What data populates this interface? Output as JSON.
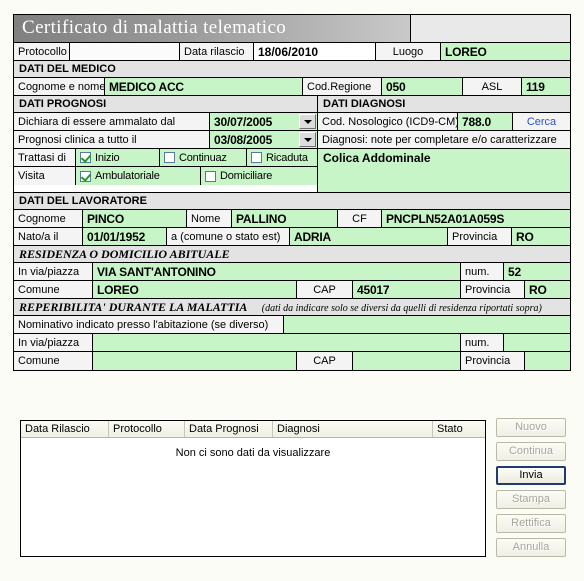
{
  "title": "Certificato di malattia telematico",
  "header_row": {
    "protocollo_label": "Protocollo",
    "protocollo_value": "",
    "data_rilascio_label": "Data rilascio",
    "data_rilascio_value": "18/06/2010",
    "luogo_label": "Luogo",
    "luogo_value": "LOREO"
  },
  "medico": {
    "section": "DATI DEL MEDICO",
    "cognome_label": "Cognome e nome",
    "cognome_value": "MEDICO ACC",
    "cod_regione_label": "Cod.Regione",
    "cod_regione_value": "050",
    "asl_label": "ASL",
    "asl_value": "119"
  },
  "prognosi": {
    "section": "DATI PROGNOSI",
    "ammalato_label": "Dichiara di essere ammalato dal",
    "ammalato_value": "30/07/2005",
    "prognosi_label": "Prognosi clinica a tutto il",
    "prognosi_value": "03/08/2005",
    "trattasi_label": "Trattasi di",
    "trattasi_options": [
      {
        "label": "Inizio",
        "checked": true
      },
      {
        "label": "Continuaz",
        "checked": false
      },
      {
        "label": "Ricaduta",
        "checked": false
      }
    ],
    "visita_label": "Visita",
    "visita_options": [
      {
        "label": "Ambulatoriale",
        "checked": true
      },
      {
        "label": "Domiciliare",
        "checked": false
      }
    ]
  },
  "diagnosi": {
    "section": "DATI DIAGNOSI",
    "cod_label": "Cod. Nosologico (ICD9-CM)",
    "cod_value": "788.0",
    "cerca_link": "Cerca",
    "note_label": "Diagnosi: note per completare e/o caratterizzare",
    "note_value": "Colica Addominale"
  },
  "lavoratore": {
    "section": "DATI DEL LAVORATORE",
    "cognome_label": "Cognome",
    "cognome_value": "PINCO",
    "nome_label": "Nome",
    "nome_value": "PALLINO",
    "cf_label": "CF",
    "cf_value": "PNCPLN52A01A059S",
    "nato_label": "Nato/a il",
    "nato_value": "01/01/1952",
    "comune_nascita_label": "a (comune o stato est)",
    "comune_nascita_value": "ADRIA",
    "provincia_label": "Provincia",
    "provincia_value": "RO"
  },
  "residenza": {
    "section": "RESIDENZA O DOMICILIO ABITUALE",
    "via_label": "In via/piazza",
    "via_value": "VIA SANT'ANTONINO",
    "num_label": "num.",
    "num_value": "52",
    "comune_label": "Comune",
    "comune_value": "LOREO",
    "cap_label": "CAP",
    "cap_value": "45017",
    "provincia_label": "Provincia",
    "provincia_value": "RO"
  },
  "reperibilita": {
    "section": "REPERIBILITA' DURANTE LA MALATTIA",
    "section_note": "(dati da indicare solo se diversi da quelli di residenza riportati sopra)",
    "nominativo_label": "Nominativo indicato presso l'abitazione (se diverso)",
    "nominativo_value": "",
    "via_label": "In via/piazza",
    "via_value": "",
    "num_label": "num.",
    "num_value": "",
    "comune_label": "Comune",
    "comune_value": "",
    "cap_label": "CAP",
    "cap_value": "",
    "provincia_label": "Provincia",
    "provincia_value": ""
  },
  "grid": {
    "columns": [
      "Data Rilascio",
      "Protocollo",
      "Data Prognosi",
      "Diagnosi",
      "Stato"
    ],
    "empty_message": "Non ci sono dati da visualizzare",
    "rows": []
  },
  "buttons": [
    {
      "label": "Nuovo",
      "enabled": false
    },
    {
      "label": "Continua",
      "enabled": false
    },
    {
      "label": "Invia",
      "enabled": true
    },
    {
      "label": "Stampa",
      "enabled": false
    },
    {
      "label": "Rettifica",
      "enabled": false
    },
    {
      "label": "Annulla",
      "enabled": false
    }
  ],
  "colors": {
    "value_green": "#c8f5c8",
    "label_gray": "#f4f4f4",
    "section_gray": "#e3e3e3",
    "link_blue": "#2850d0",
    "focus_border": "#203a6e",
    "page_bg": "#fcfcf7"
  }
}
